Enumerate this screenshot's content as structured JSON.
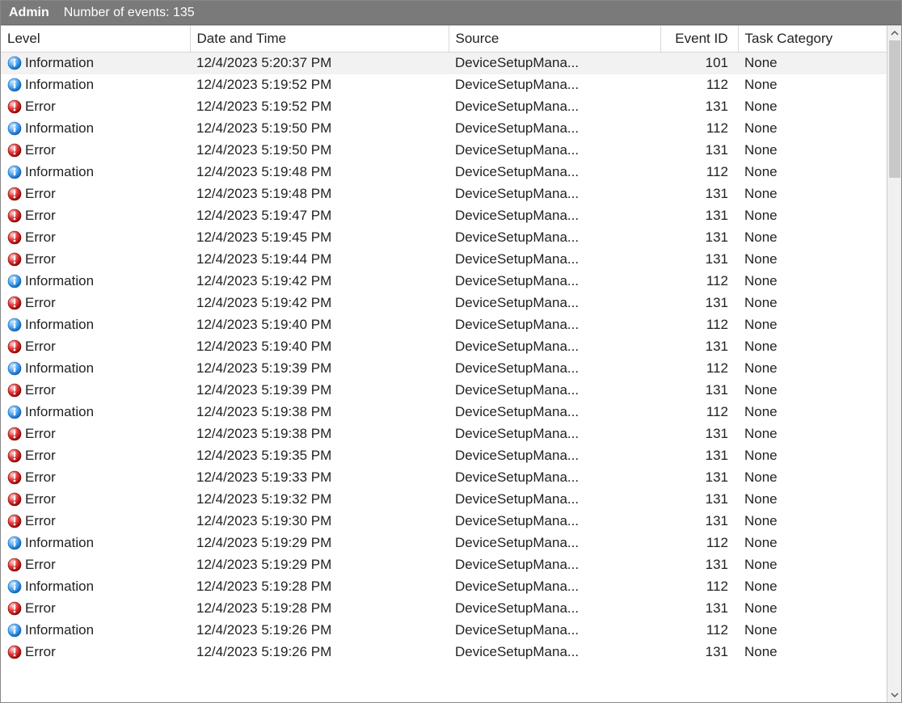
{
  "titlebar": {
    "label": "Admin",
    "subtitle": "Number of events: 135"
  },
  "columns": {
    "level": "Level",
    "datetime": "Date and Time",
    "source": "Source",
    "eventid": "Event ID",
    "task": "Task Category"
  },
  "events": [
    {
      "level": "Information",
      "datetime": "12/4/2023 5:20:37 PM",
      "source": "DeviceSetupMana...",
      "event_id": 101,
      "task": "None",
      "selected": true
    },
    {
      "level": "Information",
      "datetime": "12/4/2023 5:19:52 PM",
      "source": "DeviceSetupMana...",
      "event_id": 112,
      "task": "None"
    },
    {
      "level": "Error",
      "datetime": "12/4/2023 5:19:52 PM",
      "source": "DeviceSetupMana...",
      "event_id": 131,
      "task": "None"
    },
    {
      "level": "Information",
      "datetime": "12/4/2023 5:19:50 PM",
      "source": "DeviceSetupMana...",
      "event_id": 112,
      "task": "None"
    },
    {
      "level": "Error",
      "datetime": "12/4/2023 5:19:50 PM",
      "source": "DeviceSetupMana...",
      "event_id": 131,
      "task": "None"
    },
    {
      "level": "Information",
      "datetime": "12/4/2023 5:19:48 PM",
      "source": "DeviceSetupMana...",
      "event_id": 112,
      "task": "None"
    },
    {
      "level": "Error",
      "datetime": "12/4/2023 5:19:48 PM",
      "source": "DeviceSetupMana...",
      "event_id": 131,
      "task": "None"
    },
    {
      "level": "Error",
      "datetime": "12/4/2023 5:19:47 PM",
      "source": "DeviceSetupMana...",
      "event_id": 131,
      "task": "None"
    },
    {
      "level": "Error",
      "datetime": "12/4/2023 5:19:45 PM",
      "source": "DeviceSetupMana...",
      "event_id": 131,
      "task": "None"
    },
    {
      "level": "Error",
      "datetime": "12/4/2023 5:19:44 PM",
      "source": "DeviceSetupMana...",
      "event_id": 131,
      "task": "None"
    },
    {
      "level": "Information",
      "datetime": "12/4/2023 5:19:42 PM",
      "source": "DeviceSetupMana...",
      "event_id": 112,
      "task": "None"
    },
    {
      "level": "Error",
      "datetime": "12/4/2023 5:19:42 PM",
      "source": "DeviceSetupMana...",
      "event_id": 131,
      "task": "None"
    },
    {
      "level": "Information",
      "datetime": "12/4/2023 5:19:40 PM",
      "source": "DeviceSetupMana...",
      "event_id": 112,
      "task": "None"
    },
    {
      "level": "Error",
      "datetime": "12/4/2023 5:19:40 PM",
      "source": "DeviceSetupMana...",
      "event_id": 131,
      "task": "None"
    },
    {
      "level": "Information",
      "datetime": "12/4/2023 5:19:39 PM",
      "source": "DeviceSetupMana...",
      "event_id": 112,
      "task": "None"
    },
    {
      "level": "Error",
      "datetime": "12/4/2023 5:19:39 PM",
      "source": "DeviceSetupMana...",
      "event_id": 131,
      "task": "None"
    },
    {
      "level": "Information",
      "datetime": "12/4/2023 5:19:38 PM",
      "source": "DeviceSetupMana...",
      "event_id": 112,
      "task": "None"
    },
    {
      "level": "Error",
      "datetime": "12/4/2023 5:19:38 PM",
      "source": "DeviceSetupMana...",
      "event_id": 131,
      "task": "None"
    },
    {
      "level": "Error",
      "datetime": "12/4/2023 5:19:35 PM",
      "source": "DeviceSetupMana...",
      "event_id": 131,
      "task": "None"
    },
    {
      "level": "Error",
      "datetime": "12/4/2023 5:19:33 PM",
      "source": "DeviceSetupMana...",
      "event_id": 131,
      "task": "None"
    },
    {
      "level": "Error",
      "datetime": "12/4/2023 5:19:32 PM",
      "source": "DeviceSetupMana...",
      "event_id": 131,
      "task": "None"
    },
    {
      "level": "Error",
      "datetime": "12/4/2023 5:19:30 PM",
      "source": "DeviceSetupMana...",
      "event_id": 131,
      "task": "None"
    },
    {
      "level": "Information",
      "datetime": "12/4/2023 5:19:29 PM",
      "source": "DeviceSetupMana...",
      "event_id": 112,
      "task": "None"
    },
    {
      "level": "Error",
      "datetime": "12/4/2023 5:19:29 PM",
      "source": "DeviceSetupMana...",
      "event_id": 131,
      "task": "None"
    },
    {
      "level": "Information",
      "datetime": "12/4/2023 5:19:28 PM",
      "source": "DeviceSetupMana...",
      "event_id": 112,
      "task": "None"
    },
    {
      "level": "Error",
      "datetime": "12/4/2023 5:19:28 PM",
      "source": "DeviceSetupMana...",
      "event_id": 131,
      "task": "None"
    },
    {
      "level": "Information",
      "datetime": "12/4/2023 5:19:26 PM",
      "source": "DeviceSetupMana...",
      "event_id": 112,
      "task": "None"
    },
    {
      "level": "Error",
      "datetime": "12/4/2023 5:19:26 PM",
      "source": "DeviceSetupMana...",
      "event_id": 131,
      "task": "None"
    }
  ]
}
